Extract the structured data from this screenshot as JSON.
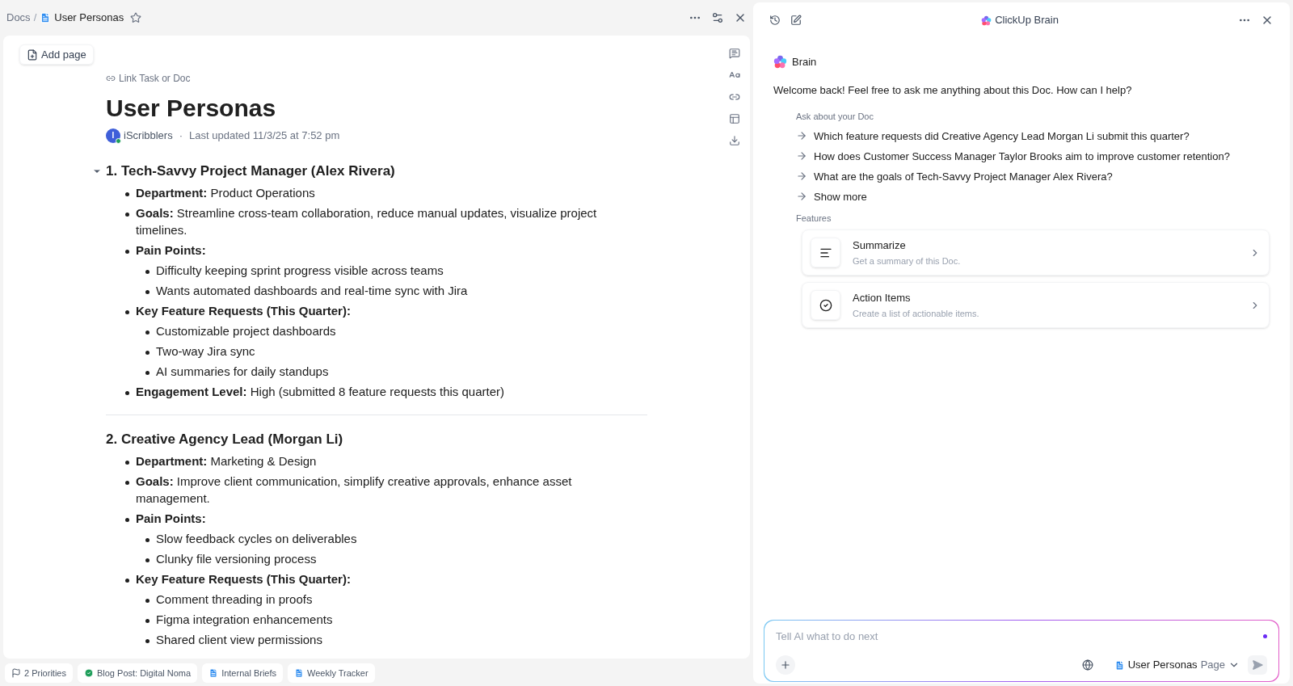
{
  "doc_header": {
    "breadcrumb_root": "Docs",
    "separator": "/",
    "doc_name": "User Personas",
    "starred": false
  },
  "add_page": "Add page",
  "link_task": "Link Task or Doc",
  "title": "User Personas",
  "author": {
    "initial": "I",
    "name": "iScribblers",
    "online": true
  },
  "meta_dot": "·",
  "updated": "Last updated 11/3/25 at 7:52 pm",
  "sections": [
    {
      "heading": "1. Tech-Savvy Project Manager (Alex Rivera)",
      "show_toggle": true,
      "fields": [
        {
          "label": "Department:",
          "text": "Product Operations"
        },
        {
          "label": "Goals:",
          "text": "Streamline cross-team collaboration, reduce manual updates, visualize project timelines."
        },
        {
          "label": "Pain Points:",
          "items": [
            "Difficulty keeping sprint progress visible across teams",
            "Wants automated dashboards and real-time sync with Jira"
          ]
        },
        {
          "label": "Key Feature Requests (This Quarter):",
          "items": [
            "Customizable project dashboards",
            "Two-way Jira sync",
            "AI summaries for daily standups"
          ]
        },
        {
          "label": "Engagement Level:",
          "text": "High (submitted 8 feature requests this quarter)"
        }
      ]
    },
    {
      "heading": "2. Creative Agency Lead (Morgan Li)",
      "show_toggle": false,
      "fields": [
        {
          "label": "Department:",
          "text": "Marketing & Design"
        },
        {
          "label": "Goals:",
          "text": "Improve client communication, simplify creative approvals, enhance asset management."
        },
        {
          "label": "Pain Points:",
          "items": [
            "Slow feedback cycles on deliverables",
            "Clunky file versioning process"
          ]
        },
        {
          "label": "Key Feature Requests (This Quarter):",
          "items": [
            "Comment threading in proofs",
            "Figma integration enhancements",
            "Shared client view permissions"
          ]
        }
      ]
    }
  ],
  "bottom_tabs": [
    {
      "kind": "priority",
      "label": "2 Priorities"
    },
    {
      "kind": "task",
      "label": "Blog Post: Digital Noma"
    },
    {
      "kind": "doc",
      "label": "Internal Briefs"
    },
    {
      "kind": "doc",
      "label": "Weekly Tracker"
    }
  ],
  "brain": {
    "title": "ClickUp Brain",
    "name": "Brain",
    "welcome": "Welcome back! Feel free to ask me anything about this Doc. How can I help?",
    "ask_heading": "Ask about your Doc",
    "suggestions": [
      "Which feature requests did Creative Agency Lead Morgan Li submit this quarter?",
      "How does Customer Success Manager Taylor Brooks aim to improve customer retention?",
      "What are the goals of Tech-Savvy Project Manager Alex Rivera?",
      "Show more"
    ],
    "features_heading": "Features",
    "features": [
      {
        "kind": "summarize",
        "title": "Summarize",
        "description": "Get a summary of this Doc."
      },
      {
        "kind": "action_items",
        "title": "Action Items",
        "description": "Create a list of actionable items."
      }
    ],
    "input": {
      "placeholder": "Tell AI what to do next",
      "context_name": "User Personas",
      "context_type": "Page"
    }
  }
}
